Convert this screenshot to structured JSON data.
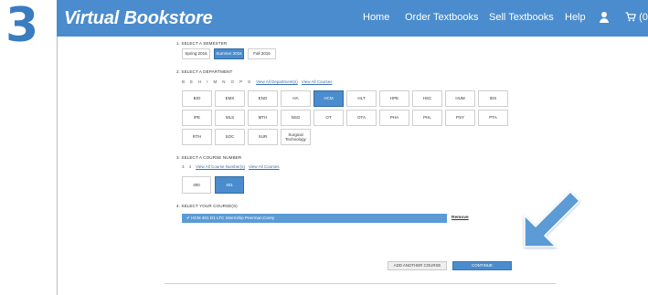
{
  "step_number": "3",
  "header": {
    "brand": "Virtual Bookstore",
    "nav": {
      "home": "Home",
      "order": "Order Textbooks",
      "sell": "Sell Textbooks",
      "help": "Help",
      "cart_count": "(0)"
    }
  },
  "sections": {
    "semester": {
      "title": "1. SELECT A SEMESTER",
      "options": [
        "Spring 2016",
        "Summer 2016",
        "Fall 2016"
      ],
      "selected": "Summer 2016"
    },
    "department": {
      "title": "2. SELECT A DEPARTMENT",
      "letters": [
        "B",
        "E",
        "H",
        "I",
        "M",
        "N",
        "O",
        "P",
        "S"
      ],
      "view_all_departments": "View All Department(s)",
      "view_all_courses": "View All Courses",
      "options": [
        "BIO",
        "EMS",
        "ENG",
        "HA",
        "HCM",
        "HLT",
        "HPE",
        "HSC",
        "HUM",
        "IDS",
        "IPE",
        "MLS",
        "MTH",
        "NSG",
        "OT",
        "OTA",
        "PHA",
        "PHL",
        "PSY",
        "PTA",
        "RTH",
        "SOC",
        "SUR",
        "Surgical Technology"
      ],
      "selected": "HCM"
    },
    "course_number": {
      "title": "3. SELECT A COURSE NUMBER",
      "digits": [
        "3",
        "4"
      ],
      "view_all_course_numbers": "View All Course Number(s)",
      "view_all_courses": "View All Courses",
      "options": [
        "300",
        "401"
      ],
      "selected": "401"
    },
    "your_courses": {
      "title": "4. SELECT YOUR COURSE(S)",
      "selected_course": "✔ HCM 401 D1 LTC Internship Peerman,Carey",
      "remove_label": "Remove"
    }
  },
  "actions": {
    "add_another": "ADD ANOTHER COURSE",
    "continue": "CONTINUE"
  },
  "colors": {
    "brand_blue": "#4a8ccd",
    "selected_blue": "#4a8ccd",
    "step_blue": "#3a7cc0",
    "arrow_blue": "#5b9bd5"
  },
  "icons": {
    "user": "user-icon",
    "cart": "cart-icon",
    "arrow": "arrow-down-left-icon"
  }
}
